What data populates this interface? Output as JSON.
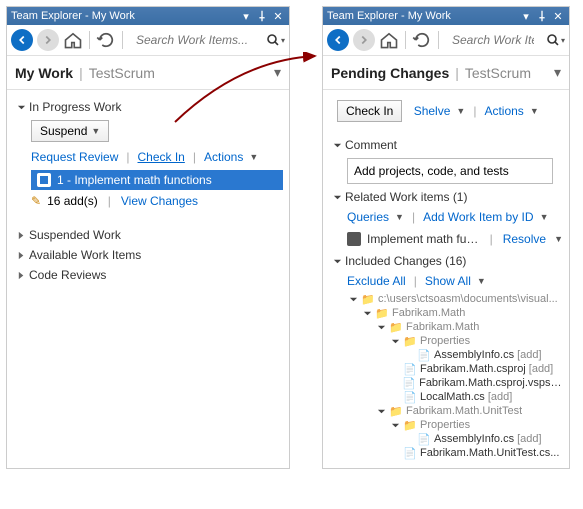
{
  "left": {
    "title": "Team Explorer - My Work",
    "search_placeholder": "Search Work Items...",
    "header_title": "My Work",
    "header_sub": "TestScrum",
    "section1": "In Progress Work",
    "suspend_btn": "Suspend",
    "request_review": "Request Review",
    "check_in": "Check In",
    "actions": "Actions",
    "selected_item": "1 - Implement math functions",
    "adds_text": "16 add(s)",
    "view_changes": "View Changes",
    "section2": "Suspended Work",
    "section3": "Available Work Items",
    "section4": "Code Reviews"
  },
  "right": {
    "title": "Team Explorer - My Work",
    "search_placeholder": "Search Work Items...",
    "header_title": "Pending Changes",
    "header_sub": "TestScrum",
    "check_in_btn": "Check In",
    "shelve": "Shelve",
    "actions": "Actions",
    "comment_section": "Comment",
    "comment_value": "Add projects, code, and tests",
    "related_section": "Related Work items (1)",
    "queries": "Queries",
    "add_by_id": "Add Work Item by ID",
    "work_item": "Implement math funct...",
    "resolve": "Resolve",
    "included_section": "Included Changes (16)",
    "exclude_all": "Exclude All",
    "show_all": "Show All",
    "tree": {
      "root": "c:\\users\\ctsoasm\\documents\\visual...",
      "fm": "Fabrikam.Math",
      "fm2": "Fabrikam.Math",
      "props": "Properties",
      "asm": "AssemblyInfo.cs",
      "add": "[add]",
      "csproj": "Fabrikam.Math.csproj",
      "vspscc": "Fabrikam.Math.csproj.vspscc...",
      "local": "LocalMath.cs",
      "ut": "Fabrikam.Math.UnitTest",
      "props2": "Properties",
      "asm2": "AssemblyInfo.cs",
      "utcs": "Fabrikam.Math.UnitTest.cs..."
    }
  }
}
